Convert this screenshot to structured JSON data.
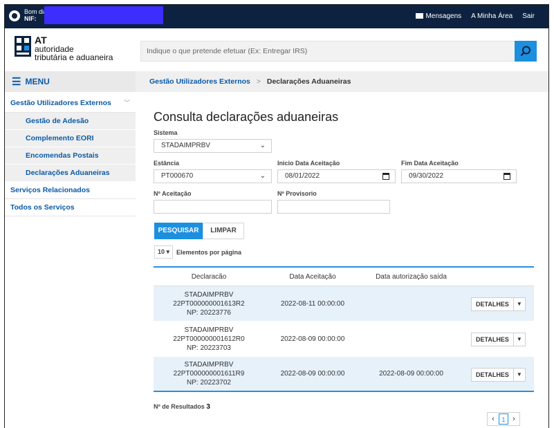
{
  "topbar": {
    "greeting": "Bom dia,",
    "nif_label": "NIF:",
    "nav": {
      "messages": "Mensagens",
      "my_area": "A Minha Área",
      "logout": "Sair"
    }
  },
  "header": {
    "logo": {
      "at": "AT",
      "line1": "autoridade",
      "line2": "tributária e aduaneira"
    },
    "search": {
      "placeholder": "Indique o que pretende efetuar (Ex: Entregar IRS)"
    }
  },
  "sidebar": {
    "menu_label": "MENU",
    "group": "Gestão Utilizadores Externos",
    "sub_items": [
      "Gestão de Adesão",
      "Complemento EORI",
      "Encomendas Postais",
      "Declarações Aduaneiras"
    ],
    "items": [
      "Serviços Relacionados",
      "Todos os Serviços"
    ]
  },
  "breadcrumb": {
    "parent": "Gestão Utilizadores Externos",
    "separator": ">",
    "current": "Declarações Aduaneiras"
  },
  "form": {
    "title": "Consulta declarações aduaneiras",
    "sistema": {
      "label": "Sistema",
      "value": "STADAIMPRBV"
    },
    "estancia": {
      "label": "Estância",
      "value": "PT000670"
    },
    "inicio": {
      "label": "Inicio Data Aceitação",
      "value": "08/01/2022"
    },
    "fim": {
      "label": "Fim Data Aceitação",
      "value": "09/30/2022"
    },
    "aceitacao": {
      "label": "Nº Aceitação",
      "value": ""
    },
    "provisorio": {
      "label": "Nº Provisorio",
      "value": ""
    },
    "search_button": "PESQUISAR",
    "clear_button": "LIMPAR",
    "per_page_value": "10",
    "per_page_label": "Elementos por página"
  },
  "table": {
    "headers": [
      "Declaracão",
      "Data Aceitação",
      "Data autorização saída"
    ],
    "rows": [
      {
        "sistema": "STADAIMPRBV",
        "ref": "22PT000000001613R2",
        "np": "NP: 20223776",
        "data": "2022-08-11 00:00:00",
        "saida": "",
        "action": "DETALHES"
      },
      {
        "sistema": "STADAIMPRBV",
        "ref": "22PT000000001612R0",
        "np": "NP: 20223703",
        "data": "2022-08-09 00:00:00",
        "saida": "",
        "action": "DETALHES"
      },
      {
        "sistema": "STADAIMPRBV",
        "ref": "22PT000000001611R9",
        "np": "NP: 20223702",
        "data": "2022-08-09 00:00:00",
        "saida": "2022-08-09 00:00:00",
        "action": "DETALHES"
      }
    ]
  },
  "results": {
    "label": "Nº de Resultados",
    "count": "3"
  },
  "pagination": {
    "prev": "‹",
    "current": "1",
    "next": "›"
  },
  "colors": {
    "topbar": "#0d2240",
    "accent": "#1c8fdf",
    "link": "#0a5aa8",
    "row_alt": "#e7f1fa"
  }
}
